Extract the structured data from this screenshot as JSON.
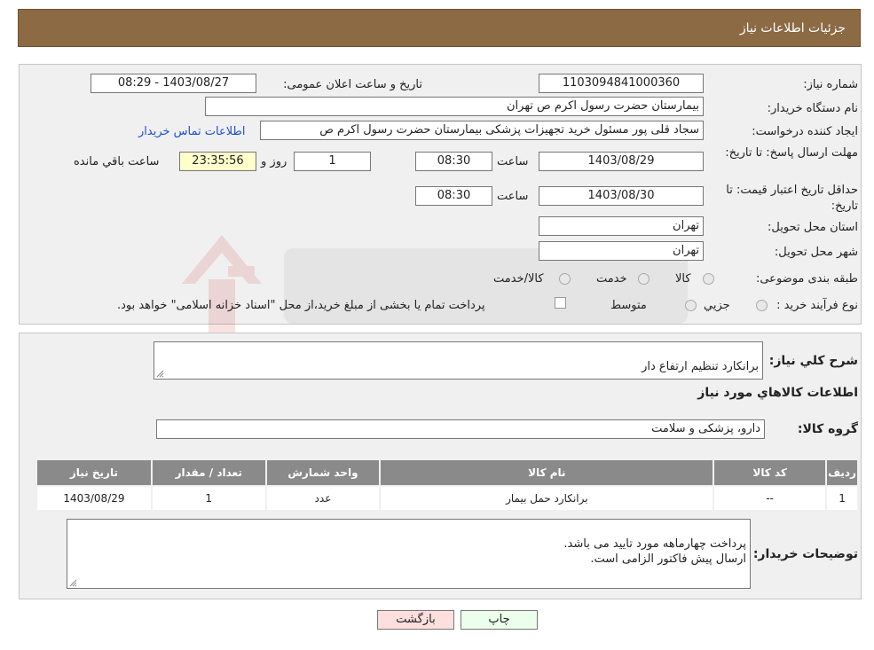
{
  "page": {
    "title": "جزئیات اطلاعات نیاز"
  },
  "form": {
    "need_number": {
      "label": "شماره نیاز:",
      "value": "1103094841000360"
    },
    "announce_datetime": {
      "label": "تاریخ و ساعت اعلان عمومی:",
      "value": "1403/08/27 - 08:29"
    },
    "buyer_org": {
      "label": "نام دستگاه خریدار:",
      "value": "بیمارستان حضرت رسول اکرم ص  تهران"
    },
    "requester": {
      "label": "ایجاد کننده درخواست:",
      "value": "سجاد قلی پور مسئول خرید تجهیزات پزشکی  بیمارستان حضرت رسول اکرم ص",
      "contact_link": "اطلاعات تماس خریدار"
    },
    "reply_deadline": {
      "label": "مهلت ارسال پاسخ: تا تاریخ:",
      "date": "1403/08/29",
      "time_label": "ساعت",
      "time": "08:30",
      "days": "1",
      "days_label": "روز و",
      "remaining": "23:35:56",
      "remaining_label": "ساعت باقي مانده"
    },
    "price_validity": {
      "label": "حداقل تاریخ اعتبار قیمت: تا تاریخ:",
      "date": "1403/08/30",
      "time_label": "ساعت",
      "time": "08:30"
    },
    "delivery_province": {
      "label": "استان محل تحویل:",
      "value": "تهران"
    },
    "delivery_city": {
      "label": "شهر محل تحویل:",
      "value": "تهران"
    },
    "category": {
      "label": "طبقه بندی موضوعی:",
      "options": [
        "کالا",
        "خدمت",
        "کالا/خدمت"
      ]
    },
    "purchase_type": {
      "label": "نوع فرآیند خرید :",
      "options": [
        "جزیي",
        "متوسط"
      ],
      "note": "پرداخت تمام یا بخشی از مبلغ خرید،از محل \"اسناد خزانه اسلامی\" خواهد بود."
    }
  },
  "summary": {
    "label": "شرح كلي نياز:",
    "value": "برانکارد تنظیم ارتفاع دار",
    "goods_heading": "اطلاعات كالاهاي مورد نياز",
    "group_label": "گروه کالا:",
    "group_value": "دارو، پزشکی و سلامت"
  },
  "table": {
    "headers": [
      "رديف",
      "کد کالا",
      "نام کالا",
      "واحد شمارش",
      "تعداد / مقدار",
      "تاريخ نياز"
    ],
    "rows": [
      [
        "1",
        "--",
        "برانکارد حمل بیمار",
        "عدد",
        "1",
        "1403/08/29"
      ]
    ]
  },
  "buyer_notes": {
    "label": "توضیحات خریدار:",
    "value": "پرداخت چهارماهه مورد تایید می باشد.\nارسال پیش فاکتور الزامی است."
  },
  "buttons": {
    "print": "چاپ",
    "back": "بازگشت"
  },
  "colors": {
    "header": "#8c6a43",
    "back_button": "#ffdede",
    "print_button": "#ecffec",
    "link": "#1a4fd6"
  }
}
